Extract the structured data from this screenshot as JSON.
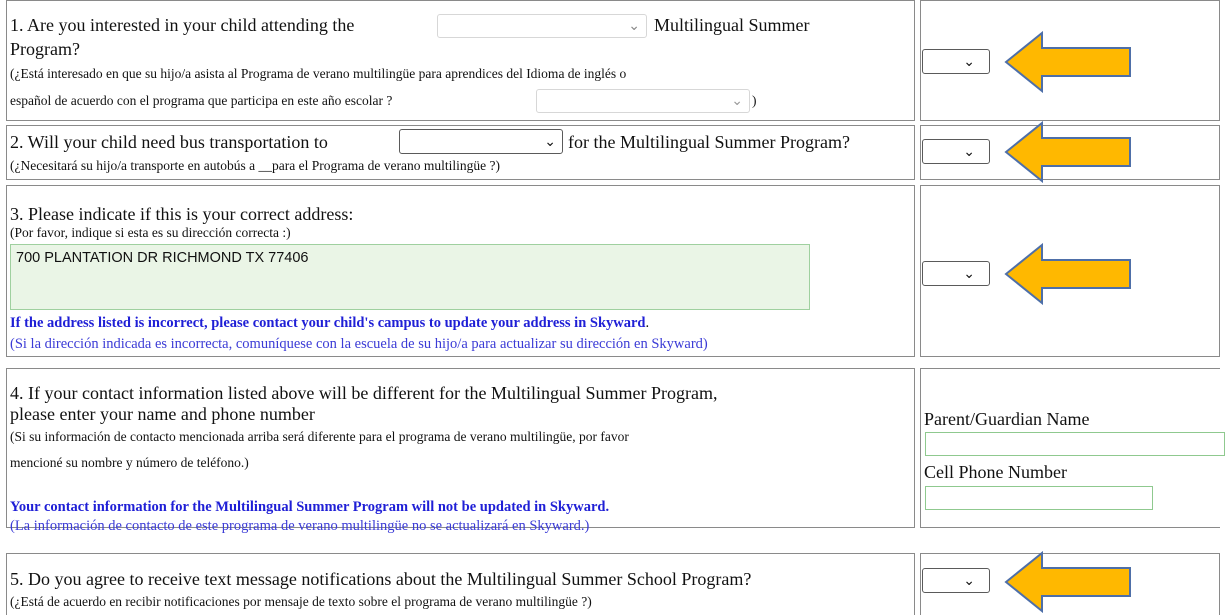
{
  "q1": {
    "question_prefix": "1. Are you interested in your child attending the",
    "question_suffix": "Multilingual Summer",
    "question_line2": "Program?",
    "spanish_line1": "(¿Está interesado en que su hijo/a asista al Programa de verano multilingüe para aprendices del Idioma de inglés o",
    "spanish_line2": "español de acuerdo con el programa que participa en este año escolar ?",
    "spanish_close": ")"
  },
  "q2": {
    "question_prefix": "2. Will your child need bus transportation to",
    "question_suffix": "for the Multilingual Summer Program?",
    "spanish": "(¿Necesitará su hijo/a transporte en autobús a __para el Programa de verano multilingüe ?)"
  },
  "q3": {
    "question": "3. Please indicate if this is your correct address:",
    "spanish": "(Por favor, indique si esta es su dirección correcta :)",
    "address_value": "700 PLANTATION DR RICHMOND TX 77406",
    "note_en": "If the address listed is incorrect, please contact your child's campus to update your address in Skyward",
    "note_en_end": ".",
    "note_es": "(Si la dirección indicada es incorrecta, comuníquese con la escuela de su hijo/a para actualizar su dirección en Skyward)"
  },
  "q4": {
    "question_line1": "4. If your contact information listed above will be different for the Multilingual Summer Program,",
    "question_line2": "please enter your name and phone number",
    "spanish_line1": "(Si su información de contacto mencionada arriba será diferente para el programa de verano multilingüe, por favor",
    "spanish_line2": "mencioné su nombre y número de teléfono.)",
    "note_en": "Your contact information for the Multilingual Summer Program will not be updated in Skyward.",
    "note_es": "(La información de contacto de este programa de verano multilingüe no se actualizará en Skyward.)",
    "parent_label": "Parent/Guardian Name",
    "phone_label": "Cell Phone Number",
    "parent_value": "",
    "phone_value": ""
  },
  "q5": {
    "question": "5. Do you agree to receive text message notifications about the Multilingual Summer School Program?",
    "spanish": "(¿Está de acuerdo en recibir notificaciones por mensaje de texto sobre el programa de verano multilingüe ?)"
  },
  "icons": {
    "chevron": "chevron-down-icon",
    "arrow": "arrow-left-icon"
  },
  "colors": {
    "arrow_fill": "#FFB800",
    "arrow_stroke": "#4E6FA8",
    "blue_text": "#1f1fd6",
    "input_bg": "#eaf5e6"
  }
}
